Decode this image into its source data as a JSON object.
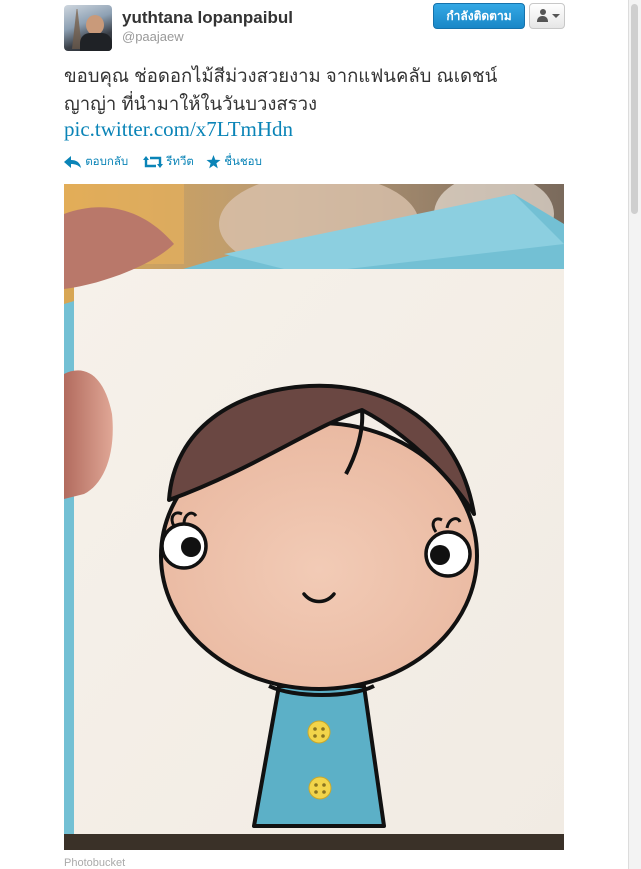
{
  "header": {
    "display_name": "yuthtana lopanpaibul",
    "screen_name": "@paajaew",
    "follow_button_label": "กำลังติดตาม",
    "user_menu_icon": "person-caret-icon"
  },
  "tweet": {
    "text_lines": [
      "ขอบคุณ ช่อดอกไม้สีม่วงสวยงาม จากแฟนคลับ ณเดชน์",
      "ญาญ่า ที่นำมาให้ในวันบวงสรวง"
    ],
    "link": "pic.twitter.com/x7LTmHdn"
  },
  "actions": [
    {
      "icon": "reply-icon",
      "label": "ตอบกลับ"
    },
    {
      "icon": "retweet-icon",
      "label": "รีทวีต"
    },
    {
      "icon": "star-icon",
      "label": "ชื่นชอบ"
    }
  ],
  "media": {
    "source": "Photobucket"
  },
  "colors": {
    "link": "#0a84b7",
    "follow_button": "#1987c7",
    "card_blue": "#5bb1c6"
  }
}
